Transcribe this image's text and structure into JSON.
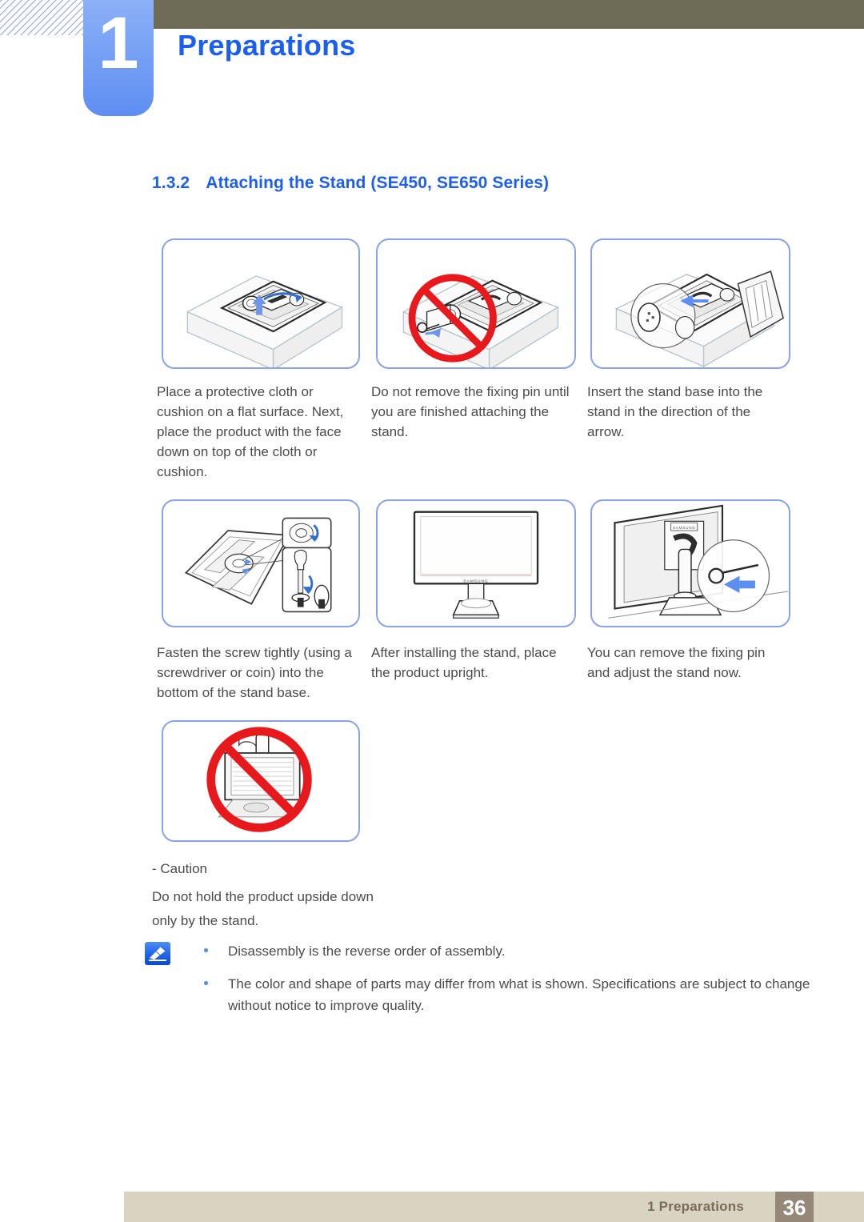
{
  "header": {
    "chapter_number": "1",
    "chapter_title": "Preparations",
    "olive_bar_color": "#6e6b57",
    "tab_color": "#7aa3f5",
    "title_color": "#1b5ef0"
  },
  "section": {
    "number": "1.3.2",
    "title": "Attaching the Stand (SE450, SE650 Series)"
  },
  "steps": [
    {
      "id": "step-1",
      "figure": "monitor-face-down-on-cushion",
      "caption": "Place a protective cloth or cushion on a flat surface. Next, place the product with the face down on top of the cloth or cushion."
    },
    {
      "id": "step-2",
      "figure": "do-not-remove-fixing-pin-prohibited",
      "caption": "Do not remove the fixing pin until you are finished attaching the stand."
    },
    {
      "id": "step-3",
      "figure": "insert-stand-base-arrow",
      "caption": "Insert the stand base into the stand in the direction of the arrow."
    },
    {
      "id": "step-4",
      "figure": "fasten-screw-with-screwdriver-or-coin",
      "caption": "Fasten the screw tightly (using a screwdriver or coin) into the bottom of the stand base."
    },
    {
      "id": "step-5",
      "figure": "monitor-upright-assembled",
      "caption": "After installing the stand, place the product upright."
    },
    {
      "id": "step-6",
      "figure": "remove-fixing-pin-rear-view",
      "caption": "You can remove the fixing pin and adjust the stand now."
    }
  ],
  "caution": {
    "label": "- Caution",
    "text": "Do not hold the product upside down only by the stand.",
    "figure": "do-not-hold-upside-down-prohibited"
  },
  "notes": {
    "icon": "note-pencil-icon",
    "items": [
      "Disassembly is the reverse order of assembly.",
      "The color and shape of parts may differ from what is shown. Specifications are subject to change without notice to improve quality."
    ]
  },
  "monitor_label": "SAMSUNG",
  "footer": {
    "chapter_ref": "1 Preparations",
    "page_number": "36",
    "bar_color": "#d9d4c1",
    "badge_color": "#968878"
  }
}
